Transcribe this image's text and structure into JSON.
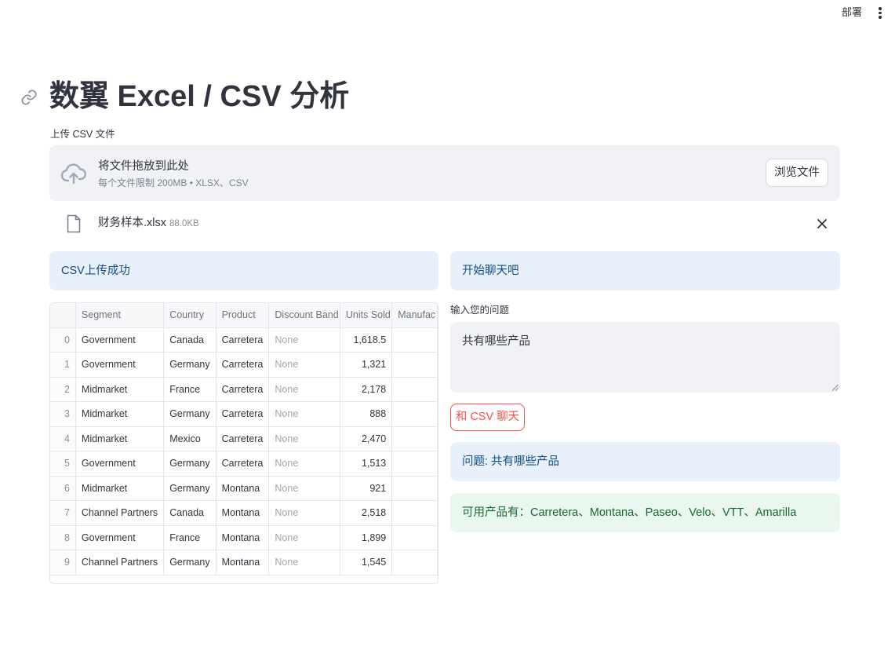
{
  "header": {
    "deploy_label": "部署",
    "menu_icon": "vertical-ellipsis-icon"
  },
  "page": {
    "title": "数翼 Excel / CSV 分析",
    "anchor_icon": "link-icon"
  },
  "uploader": {
    "label": "上传 CSV 文件",
    "drop_text": "将文件拖放到此处",
    "limit_text": "每个文件限制 200MB • XLSX、CSV",
    "browse_label": "浏览文件",
    "icon": "cloud-upload-icon"
  },
  "file": {
    "name": "财务样本.xlsx",
    "size": "88.0KB",
    "icon": "file-icon",
    "remove_icon": "close-icon"
  },
  "left": {
    "success_message": "CSV上传成功"
  },
  "table": {
    "columns": [
      "",
      "Segment",
      "Country",
      "Product",
      "Discount Band",
      "Units Sold",
      "Manufac"
    ],
    "rows": [
      [
        "0",
        "Government",
        "Canada",
        "Carretera",
        "None",
        "1,618.5",
        ""
      ],
      [
        "1",
        "Government",
        "Germany",
        "Carretera",
        "None",
        "1,321",
        ""
      ],
      [
        "2",
        "Midmarket",
        "France",
        "Carretera",
        "None",
        "2,178",
        ""
      ],
      [
        "3",
        "Midmarket",
        "Germany",
        "Carretera",
        "None",
        "888",
        ""
      ],
      [
        "4",
        "Midmarket",
        "Mexico",
        "Carretera",
        "None",
        "2,470",
        ""
      ],
      [
        "5",
        "Government",
        "Germany",
        "Carretera",
        "None",
        "1,513",
        ""
      ],
      [
        "6",
        "Midmarket",
        "Germany",
        "Montana",
        "None",
        "921",
        ""
      ],
      [
        "7",
        "Channel Partners",
        "Canada",
        "Montana",
        "None",
        "2,518",
        ""
      ],
      [
        "8",
        "Government",
        "France",
        "Montana",
        "None",
        "1,899",
        ""
      ],
      [
        "9",
        "Channel Partners",
        "Germany",
        "Montana",
        "None",
        "1,545",
        ""
      ]
    ]
  },
  "chat": {
    "start_message": "开始聊天吧",
    "input_label": "输入您的问题",
    "input_value": "共有哪些产品",
    "submit_label": "和 CSV 聊天",
    "question_message": "问题: 共有哪些产品",
    "answer_message": "可用产品有：Carretera、Montana、Paseo、Velo、VTT、Amarilla"
  },
  "colors": {
    "primary": "#ff4b4b",
    "info_bg": "#e8f0fb",
    "info_text": "#104d86",
    "success_bg": "#e9f7ee",
    "success_text": "#17692f",
    "widget_bg": "#f0f2f6"
  }
}
